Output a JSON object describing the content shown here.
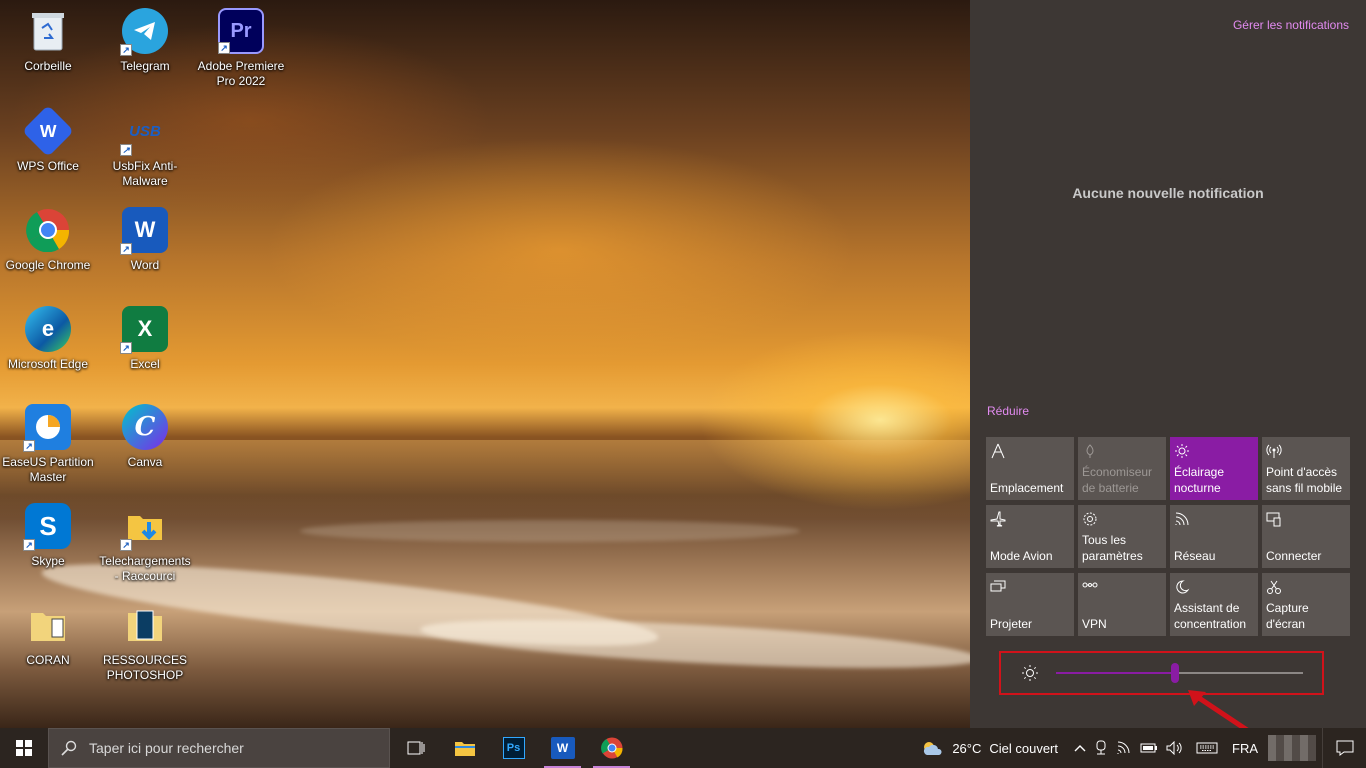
{
  "desktop": {
    "icons": [
      {
        "label": "Corbeille",
        "icon": "recycle-bin-icon"
      },
      {
        "label": "Telegram",
        "icon": "telegram-icon"
      },
      {
        "label": "Adobe Premiere Pro 2022",
        "icon": "premiere-pro-icon"
      },
      {
        "label": "WPS Office",
        "icon": "wps-office-icon"
      },
      {
        "label": "UsbFix Anti-Malware",
        "icon": "usbfix-icon"
      },
      {
        "label": "Google Chrome",
        "icon": "chrome-icon"
      },
      {
        "label": "Word",
        "icon": "word-icon"
      },
      {
        "label": "Microsoft Edge",
        "icon": "edge-icon"
      },
      {
        "label": "Excel",
        "icon": "excel-icon"
      },
      {
        "label": "EaseUS Partition Master",
        "icon": "easeus-icon"
      },
      {
        "label": "Canva",
        "icon": "canva-icon"
      },
      {
        "label": "Skype",
        "icon": "skype-icon"
      },
      {
        "label": "Telechargements - Raccourci",
        "icon": "downloads-folder-icon"
      },
      {
        "label": "CORAN",
        "icon": "folder-icon"
      },
      {
        "label": "RESSOURCES PHOTOSHOP",
        "icon": "folder-icon"
      }
    ]
  },
  "action_center": {
    "manage_notifications": "Gérer les notifications",
    "no_notifications": "Aucune nouvelle notification",
    "collapse": "Réduire",
    "tiles": [
      {
        "label": "Emplacement",
        "icon": "location-icon",
        "state": "off"
      },
      {
        "label": "Économiseur de batterie",
        "icon": "battery-saver-icon",
        "state": "disabled"
      },
      {
        "label": "Éclairage nocturne",
        "icon": "night-light-icon",
        "state": "on"
      },
      {
        "label": "Point d'accès sans fil mobile",
        "icon": "hotspot-icon",
        "state": "off"
      },
      {
        "label": "Mode Avion",
        "icon": "airplane-icon",
        "state": "off"
      },
      {
        "label": "Tous les paramètres",
        "icon": "settings-gear-icon",
        "state": "off"
      },
      {
        "label": "Réseau",
        "icon": "network-icon",
        "state": "off"
      },
      {
        "label": "Connecter",
        "icon": "connect-icon",
        "state": "off"
      },
      {
        "label": "Projeter",
        "icon": "project-icon",
        "state": "off"
      },
      {
        "label": "VPN",
        "icon": "vpn-icon",
        "state": "off"
      },
      {
        "label": "Assistant de concentration",
        "icon": "focus-assist-icon",
        "state": "off"
      },
      {
        "label": "Capture d'écran",
        "icon": "screen-snip-icon",
        "state": "off"
      }
    ],
    "brightness_percent": 48,
    "accent_color": "#8a1ca4",
    "link_color": "#e28bf0"
  },
  "taskbar": {
    "search_placeholder": "Taper ici pour rechercher",
    "pinned": [
      {
        "name": "task-view",
        "icon": "task-view-icon",
        "running": false
      },
      {
        "name": "file-explorer",
        "icon": "file-explorer-icon",
        "running": false
      },
      {
        "name": "photoshop",
        "icon": "photoshop-icon",
        "running": false
      },
      {
        "name": "word",
        "icon": "word-icon",
        "running": true
      },
      {
        "name": "chrome",
        "icon": "chrome-icon",
        "running": true
      }
    ],
    "weather": {
      "temp": "26°C",
      "condition": "Ciel couvert"
    },
    "language": "FRA"
  }
}
